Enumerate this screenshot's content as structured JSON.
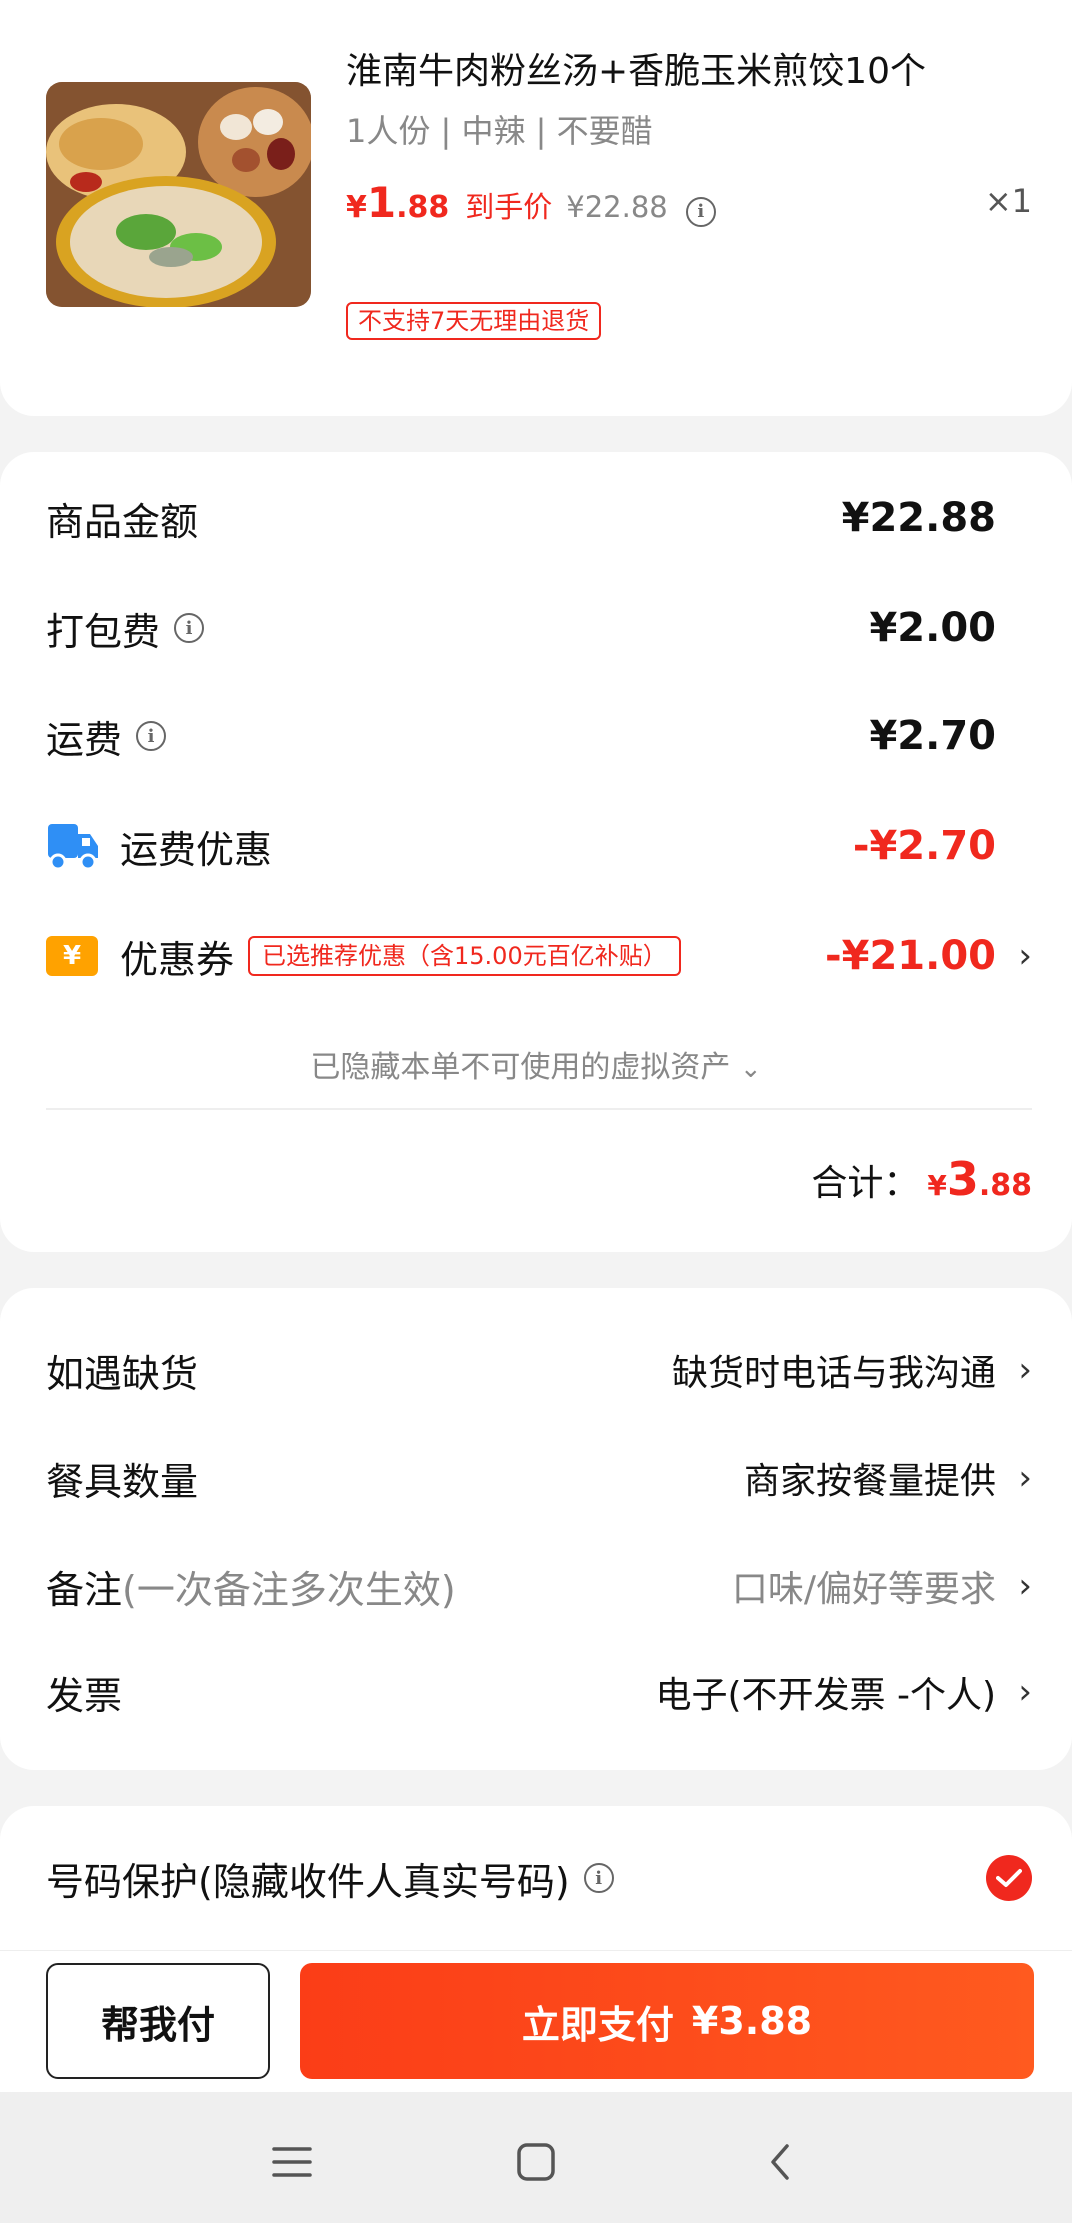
{
  "product": {
    "title": "淮南牛肉粉丝汤+香脆玉米煎饺10个",
    "spec": "1人份 | 中辣 | 不要醋",
    "price_symbol": "¥",
    "price_int": "1",
    "price_dec": ".88",
    "price_tag": "到手价",
    "original_price": "¥22.88",
    "quantity": "×1",
    "no_return_badge": "不支持7天无理由退货"
  },
  "fees": {
    "goods_label": "商品金额",
    "goods_value": "¥22.88",
    "packing_label": "打包费",
    "packing_value": "¥2.00",
    "delivery_label": "运费",
    "delivery_value": "¥2.70",
    "delivery_discount_label": "运费优惠",
    "delivery_discount_value": "-¥2.70",
    "coupon_icon_text": "¥",
    "coupon_label": "优惠券",
    "coupon_badge": "已选推荐优惠（含15.00元百亿补贴）",
    "coupon_value": "-¥21.00",
    "hidden_assets_note": "已隐藏本单不可使用的虚拟资产",
    "total_label": "合计：",
    "total_symbol": "¥",
    "total_int": "3",
    "total_dec": ".88"
  },
  "options": {
    "stockout_label": "如遇缺货",
    "stockout_value": "缺货时电话与我沟通",
    "utensils_label": "餐具数量",
    "utensils_value": "商家按餐量提供",
    "remarks_label": "备注",
    "remarks_sublabel": "(一次备注多次生效)",
    "remarks_placeholder": "口味/偏好等要求",
    "invoice_label": "发票",
    "invoice_value": "电子(不开发票 -个人)"
  },
  "privacy": {
    "label": "号码保护(隐藏收件人真实号码)",
    "checked": true
  },
  "actions": {
    "help_pay_label": "帮我付",
    "pay_now_label": "立即支付",
    "pay_now_amount": "¥3.88"
  },
  "colors": {
    "accent_red": "#f0281e",
    "coupon_orange": "#ffa200",
    "truck_blue": "#2f8ff5"
  },
  "icons": {
    "info": "info-circle-icon",
    "truck": "truck-icon",
    "coupon": "coupon-yen-icon",
    "chevron": "chevron-right-icon",
    "check": "check-circle-icon",
    "nav_menu": "menu-icon",
    "nav_home": "home-square-icon",
    "nav_back": "back-chevron-icon"
  }
}
